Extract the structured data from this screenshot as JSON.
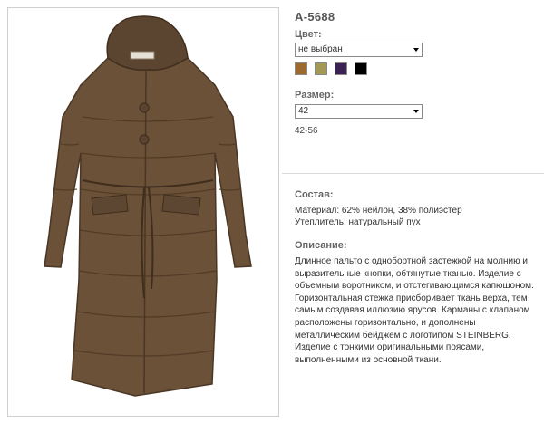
{
  "product": {
    "sku": "A-5688"
  },
  "color": {
    "label": "Цвет:",
    "selected": "не выбран",
    "swatches": [
      {
        "name": "brown",
        "hex": "#9c6a2f"
      },
      {
        "name": "olive",
        "hex": "#a19955"
      },
      {
        "name": "purple",
        "hex": "#3a2352"
      },
      {
        "name": "black",
        "hex": "#000000"
      }
    ]
  },
  "size": {
    "label": "Размер:",
    "selected": "42",
    "range": "42-56"
  },
  "composition": {
    "label": "Состав:",
    "material": "Материал: 62% нейлон, 38% полиэстер",
    "filling": "Утеплитель: натуральный пух"
  },
  "description": {
    "label": "Описание:",
    "lines": [
      "Длинное пальто с однобортной застежкой на молнию и",
      "выразительные кнопки, обтянутые тканью. Изделие с",
      "объемным воротником, и отстегивающимся капюшоном.",
      "Горизонтальная стежка присборивает ткань верха, тем",
      "самым создавая иллюзию ярусов. Карманы с клапаном",
      "расположены горизонтально, и дополнены",
      "металлическим бейджем с логотипом STEINBERG.",
      "Изделие с тонкими оригинальными поясами,",
      "выполненными из основной ткани."
    ]
  }
}
